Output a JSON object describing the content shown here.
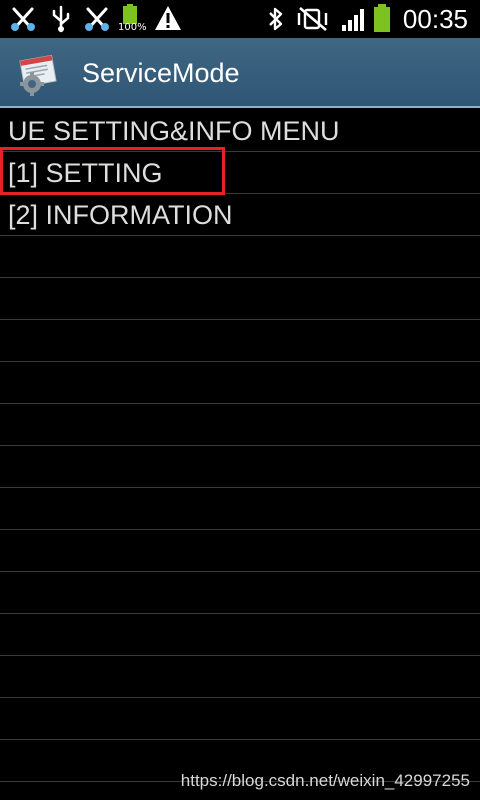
{
  "status_bar": {
    "icons": [
      "usb-debug-icon",
      "usb-icon",
      "usb-debug-icon",
      "battery-charging-icon",
      "warning-icon",
      "bluetooth-icon",
      "muted-vibrate-icon",
      "signal-icon",
      "battery-icon"
    ],
    "battery_small_label": "100%",
    "time": "00:35"
  },
  "action_bar": {
    "title": "ServiceMode",
    "icon": "service-mode-app-icon"
  },
  "menu": {
    "rows": [
      {
        "label": "UE SETTING&INFO MENU"
      },
      {
        "label": "[1] SETTING"
      },
      {
        "label": "[2] INFORMATION"
      },
      {
        "label": ""
      },
      {
        "label": ""
      },
      {
        "label": ""
      },
      {
        "label": ""
      },
      {
        "label": ""
      },
      {
        "label": ""
      },
      {
        "label": ""
      },
      {
        "label": ""
      },
      {
        "label": ""
      },
      {
        "label": ""
      },
      {
        "label": ""
      },
      {
        "label": ""
      },
      {
        "label": ""
      },
      {
        "label": ""
      }
    ]
  },
  "watermark": "https://blog.csdn.net/weixin_42997255",
  "colors": {
    "background": "#000000",
    "action_bar": "#3f6683",
    "highlight": "#e8202a",
    "battery_green": "#7cc31f"
  }
}
